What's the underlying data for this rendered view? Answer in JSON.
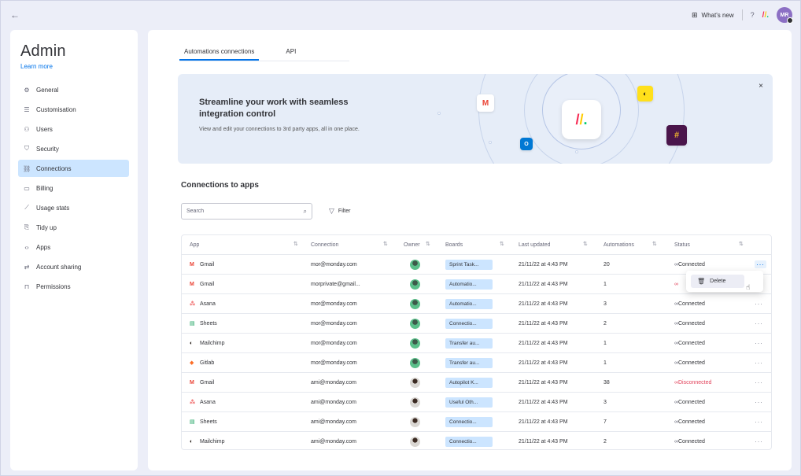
{
  "topbar": {
    "back_icon": "arrow-left-icon",
    "whats_new": "What's new",
    "help": "?",
    "avatar_initials": "MR"
  },
  "sidebar": {
    "title": "Admin",
    "learn_more": "Learn more",
    "items": [
      {
        "label": "General",
        "icon": "gear-icon",
        "active": false
      },
      {
        "label": "Customisation",
        "icon": "sliders-icon",
        "active": false
      },
      {
        "label": "Users",
        "icon": "users-icon",
        "active": false
      },
      {
        "label": "Security",
        "icon": "shield-icon",
        "active": false
      },
      {
        "label": "Connections",
        "icon": "connections-icon",
        "active": true
      },
      {
        "label": "Billing",
        "icon": "card-icon",
        "active": false
      },
      {
        "label": "Usage stats",
        "icon": "chart-icon",
        "active": false
      },
      {
        "label": "Tidy up",
        "icon": "broom-icon",
        "active": false
      },
      {
        "label": "Apps",
        "icon": "code-icon",
        "active": false
      },
      {
        "label": "Account sharing",
        "icon": "swap-icon",
        "active": false
      },
      {
        "label": "Permissions",
        "icon": "lock-icon",
        "active": false
      }
    ]
  },
  "tabs": {
    "automations": "Automations connections",
    "api": "API"
  },
  "banner": {
    "title": "Streamline your work with seamless integration control",
    "description": "View and edit your connections to 3rd party apps, all in one place.",
    "close": "×"
  },
  "connections": {
    "title": "Connections to apps",
    "search_placeholder": "Search",
    "filter_label": "Filter"
  },
  "table": {
    "headers": {
      "app": "App",
      "connection": "Connection",
      "owner": "Owner",
      "boards": "Boards",
      "last_updated": "Last updated",
      "automations": "Automations",
      "status": "Status"
    },
    "rows": [
      {
        "icon": "M",
        "icon_color": "#ea4335",
        "app": "Gmail",
        "connection": "mor@monday.com",
        "owner": "green",
        "board": "Sprint Task...",
        "updated": "21/11/22 at 4:43 PM",
        "automations": "20",
        "status": "Connected",
        "status_ok": true
      },
      {
        "icon": "M",
        "icon_color": "#ea4335",
        "app": "Gmail",
        "connection": "morprivate@gmail...",
        "owner": "green",
        "board": "Automatio...",
        "updated": "21/11/22 at 4:43 PM",
        "automations": "1",
        "status": "",
        "status_ok": false
      },
      {
        "icon": "⁂",
        "icon_color": "#f06a6a",
        "app": "Asana",
        "connection": "mor@monday.com",
        "owner": "green",
        "board": "Automatio...",
        "updated": "21/11/22 at 4:43 PM",
        "automations": "3",
        "status": "Connected",
        "status_ok": true
      },
      {
        "icon": "▤",
        "icon_color": "#0f9d58",
        "app": "Sheets",
        "connection": "mor@monday.com",
        "owner": "green",
        "board": "Connectio...",
        "updated": "21/11/22 at 4:43 PM",
        "automations": "2",
        "status": "Connected",
        "status_ok": true
      },
      {
        "icon": "◐",
        "icon_color": "#241c15",
        "app": "Mailchimp",
        "connection": "mor@monday.com",
        "owner": "green",
        "board": "Transfer au...",
        "updated": "21/11/22 at 4:43 PM",
        "automations": "1",
        "status": "Connected",
        "status_ok": true
      },
      {
        "icon": "◆",
        "icon_color": "#fc6d26",
        "app": "Gitlab",
        "connection": "mor@monday.com",
        "owner": "green",
        "board": "Transfer au...",
        "updated": "21/11/22 at 4:43 PM",
        "automations": "1",
        "status": "Connected",
        "status_ok": true
      },
      {
        "icon": "M",
        "icon_color": "#ea4335",
        "app": "Gmail",
        "connection": "ami@monday.com",
        "owner": "dark",
        "board": "Autopilot K...",
        "updated": "21/11/22 at 4:43 PM",
        "automations": "38",
        "status": "Disconnected",
        "status_ok": false
      },
      {
        "icon": "⁂",
        "icon_color": "#f06a6a",
        "app": "Asana",
        "connection": "ami@monday.com",
        "owner": "dark",
        "board": "Useful Oth...",
        "updated": "21/11/22 at 4:43 PM",
        "automations": "3",
        "status": "Connected",
        "status_ok": true
      },
      {
        "icon": "▤",
        "icon_color": "#0f9d58",
        "app": "Sheets",
        "connection": "ami@monday.com",
        "owner": "dark",
        "board": "Connectio...",
        "updated": "21/11/22 at 4:43 PM",
        "automations": "7",
        "status": "Connected",
        "status_ok": true
      },
      {
        "icon": "◐",
        "icon_color": "#241c15",
        "app": "Mailchimp",
        "connection": "ami@monday.com",
        "owner": "dark",
        "board": "Connectio...",
        "updated": "21/11/22 at 4:43 PM",
        "automations": "2",
        "status": "Connected",
        "status_ok": true
      }
    ]
  },
  "popover": {
    "delete_label": "Delete"
  },
  "colors": {
    "accent": "#0073ea",
    "active_nav": "#cce5ff",
    "disconnected": "#e2445c"
  }
}
